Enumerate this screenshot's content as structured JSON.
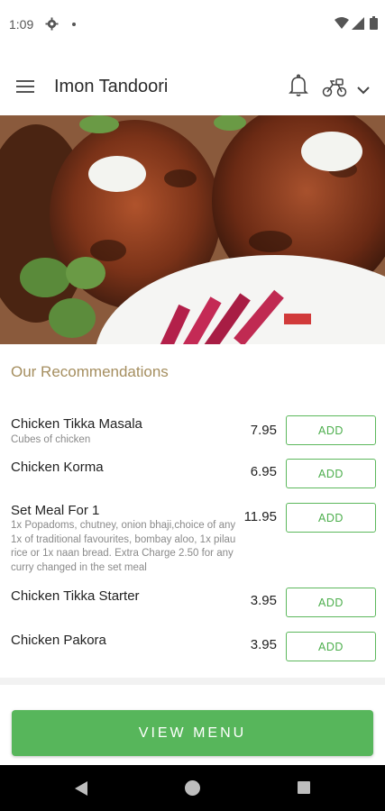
{
  "status_bar": {
    "time": "1:09",
    "icons": [
      "gear-icon",
      "dot-icon",
      "wifi-icon",
      "signal-icon",
      "battery-icon"
    ]
  },
  "app_bar": {
    "title": "Imon Tandoori",
    "icons": [
      "menu-icon",
      "bell-icon",
      "delivery-bike-icon",
      "chevron-down-icon"
    ]
  },
  "hero": {
    "icon": "food-photo"
  },
  "recommendations": {
    "title": "Our Recommendations",
    "items": [
      {
        "name": "Chicken Tikka Masala",
        "description": "Cubes of chicken",
        "price": "7.95",
        "action": "ADD"
      },
      {
        "name": "Chicken Korma",
        "description": "",
        "price": "6.95",
        "action": "ADD"
      },
      {
        "name": "Set Meal For 1",
        "description": "1x Popadoms, chutney, onion bhaji,choice of any 1x of traditional favourites, bombay aloo, 1x pilau rice or 1x naan bread.  Extra Charge 2.50 for any curry changed in the set meal",
        "price": "11.95",
        "action": "ADD"
      },
      {
        "name": "Chicken Tikka Starter",
        "description": "",
        "price": "3.95",
        "action": "ADD"
      },
      {
        "name": "Chicken Pakora",
        "description": "",
        "price": "3.95",
        "action": "ADD"
      }
    ]
  },
  "footer": {
    "view_menu": "VIEW MENU"
  },
  "nav_bar": {
    "icons": [
      "back-icon",
      "home-icon",
      "recents-icon"
    ]
  },
  "colors": {
    "accent_green": "#57b65b",
    "section_title": "#a58e5f"
  }
}
